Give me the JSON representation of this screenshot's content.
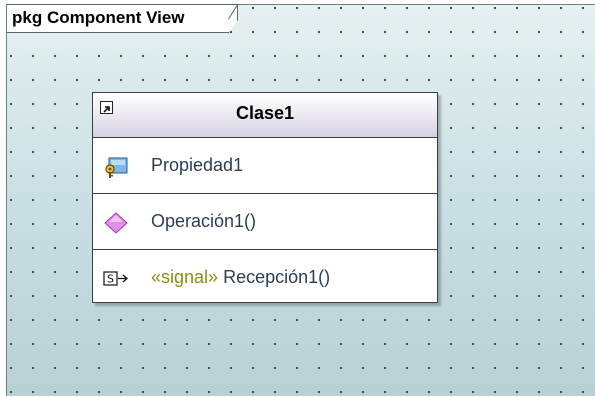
{
  "package": {
    "label": "pkg Component View"
  },
  "class": {
    "name": "Clase1",
    "property": {
      "label": "Propiedad1",
      "icon": "property-key-icon"
    },
    "operation": {
      "label": "Operación1()",
      "icon": "operation-diamond-icon"
    },
    "reception": {
      "stereotype": "«signal»",
      "label": "Recepción1()",
      "icon": "signal-reception-icon"
    }
  },
  "colors": {
    "canvas": "#c8dee2",
    "stereotype": "#8c8c14",
    "operation_icon": "#d87ee0"
  }
}
